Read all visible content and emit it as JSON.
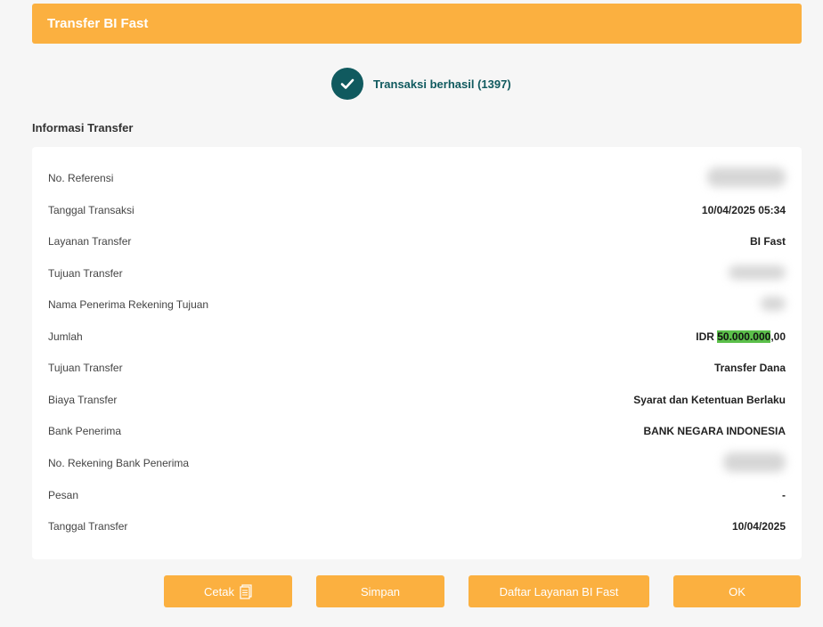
{
  "header": {
    "title": "Transfer BI Fast"
  },
  "status": {
    "text": "Transaksi berhasil (1397)",
    "icon": "check-icon",
    "color": "#105a5f"
  },
  "section": {
    "title": "Informasi Transfer"
  },
  "rows": [
    {
      "label": "No. Referensi",
      "value": ""
    },
    {
      "label": "Tanggal Transaksi",
      "value": "10/04/2025 05:34"
    },
    {
      "label": "Layanan Transfer",
      "value": "BI Fast"
    },
    {
      "label": "Tujuan Transfer",
      "value": ""
    },
    {
      "label": "Nama Penerima Rekening Tujuan",
      "value": ""
    },
    {
      "label": "Jumlah",
      "currency": "IDR ",
      "amount_highlight": "50.000.000",
      "amount_rest": ",00"
    },
    {
      "label": "Tujuan Transfer",
      "value": "Transfer Dana"
    },
    {
      "label": "Biaya Transfer",
      "value": "Syarat dan Ketentuan Berlaku"
    },
    {
      "label": "Bank Penerima",
      "value": "BANK NEGARA INDONESIA"
    },
    {
      "label": "No. Rekening Bank Penerima",
      "value": ""
    },
    {
      "label": "Pesan",
      "value": "-"
    },
    {
      "label": "Tanggal Transfer",
      "value": "10/04/2025"
    }
  ],
  "buttons": {
    "print": "Cetak",
    "save": "Simpan",
    "list": "Daftar Layanan BI Fast",
    "ok": "OK"
  },
  "colors": {
    "accent": "#fbb040",
    "primary": "#105a5f",
    "highlight": "#5bbf4a"
  }
}
